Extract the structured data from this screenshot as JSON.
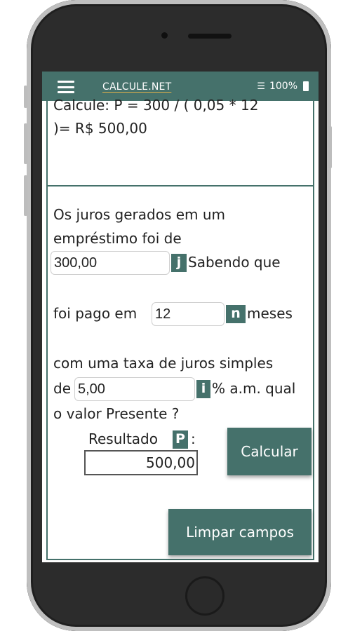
{
  "status_bar": {
    "title": "CALCULE.NET",
    "battery": "100%"
  },
  "calc": {
    "formula_line1": "Calcule: P = 300 / ( 0,05 * 12",
    "formula_line2": ")= R$ 500,00"
  },
  "form": {
    "text1": "Os juros gerados em um",
    "text2": "empréstimo foi de",
    "juros_value": "300,00",
    "juros_badge": "j",
    "text3": "Sabendo que",
    "text4": "foi pago em",
    "meses_value": "12",
    "meses_badge": "n",
    "text5": "meses",
    "text6": "com uma taxa de juros simples",
    "text7": "de",
    "taxa_value": "5,00",
    "taxa_badge": "i",
    "text8": "% a.m. qual",
    "text9": "o valor Presente ?"
  },
  "result": {
    "label": "Resultado",
    "badge": "P",
    "colon": ":",
    "value": "500,00"
  },
  "buttons": {
    "calcular": "Calcular",
    "limpar": "Limpar campos"
  },
  "colors": {
    "accent": "#45716b"
  }
}
